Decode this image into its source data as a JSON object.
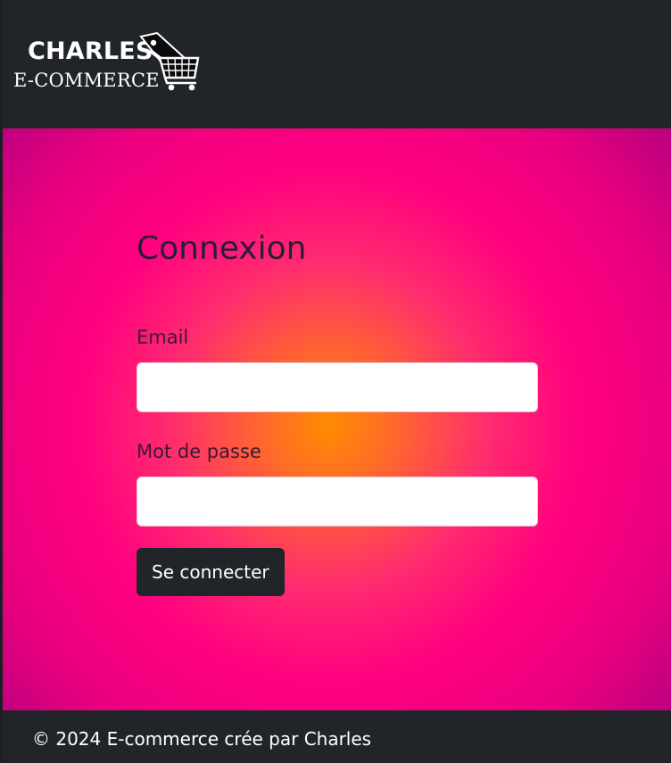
{
  "navbar": {
    "logo": {
      "line1": "CHARLES",
      "line2": "E-COMMERCE",
      "icon": "shopping-cart-icon"
    }
  },
  "login": {
    "title": "Connexion",
    "email": {
      "label": "Email",
      "value": "",
      "placeholder": ""
    },
    "password": {
      "label": "Mot de passe",
      "value": "",
      "placeholder": ""
    },
    "submit_label": "Se connecter"
  },
  "footer": {
    "text": "© 2024 E-commerce crée par Charles"
  },
  "colors": {
    "dark": "#212529",
    "gradient_center": "#ff8c00",
    "gradient_mid": "#ff0080",
    "gradient_edge": "#8a0080",
    "input_background": "#ffffff"
  }
}
